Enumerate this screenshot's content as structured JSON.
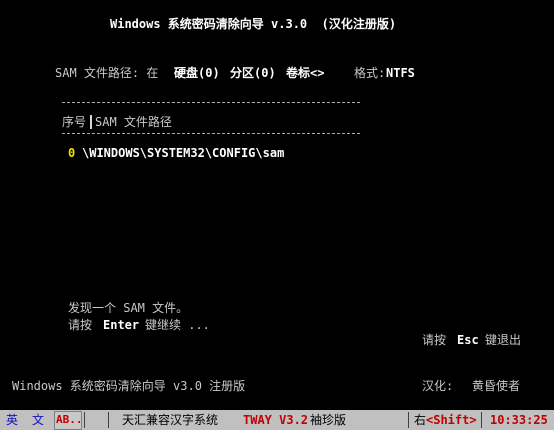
{
  "header": {
    "title": "Windows 系统密码清除向导 v.3.0  (汉化注册版)"
  },
  "info": {
    "sam_path_label": "SAM 文件路径: 在",
    "disk": "硬盘(0)",
    "partition": "分区(0)",
    "volume": "卷标<>",
    "format_label": "格式:",
    "format_value": "NTFS"
  },
  "table": {
    "col_index": "序号",
    "col_path": "SAM 文件路径",
    "rows": [
      {
        "index": "0",
        "path": "\\WINDOWS\\SYSTEM32\\CONFIG\\sam"
      }
    ]
  },
  "message": {
    "found": "发现一个 SAM 文件。",
    "press_prefix": "请按",
    "press_key": "Enter",
    "press_suffix": "键继续 ..."
  },
  "exit_hint": {
    "prefix": "请按",
    "key": "Esc",
    "suffix": "键退出"
  },
  "footer": {
    "app_name": "Windows 系统密码清除向导 v3.0 注册版",
    "translator_label": "汉化:",
    "translator": "黄昏使者"
  },
  "statusbar": {
    "lang1": "英",
    "lang2": "文",
    "mode": "AB..",
    "system_prefix": "天汇兼容汉字系统",
    "system_brand": "TWAY V3.2",
    "system_suffix": "袖珍版",
    "right_label": "右",
    "shift_key": "<Shift>",
    "time": "10:33:25",
    "colors": {
      "bar": "#c0c0c0",
      "accent_red": "#c00000",
      "accent_blue": "#1010c0"
    }
  }
}
